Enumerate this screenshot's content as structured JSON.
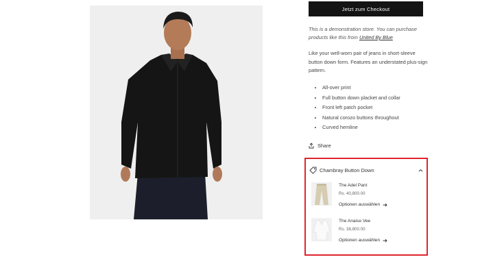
{
  "checkout": {
    "label": "Jetzt zum Checkout"
  },
  "demo_note": {
    "text": "This is a demonstration store. You can purchase products like this from ",
    "link": "United By Blue"
  },
  "description": "Like your well-worn pair of jeans in short-sleeve button down form. Features an understated plus-sign pattern.",
  "features": [
    "All-over print",
    "Full button down placket and collar",
    "Front left patch pocket",
    "Natural corozo buttons throughout",
    "Curved hemline"
  ],
  "share": {
    "label": "Share",
    "icon": "share-icon"
  },
  "related_panel": {
    "title": "Chambray Button Down",
    "icon": "tag-icon",
    "expanded": true,
    "highlight_color": "#e0242c",
    "items": [
      {
        "name": "The Adel Pant",
        "price": "Rs. 40,800.00",
        "action": "Optionen auswählen"
      },
      {
        "name": "The Anaise Vee",
        "price": "Rs. 38,800.00",
        "action": "Optionen auswählen"
      }
    ]
  }
}
